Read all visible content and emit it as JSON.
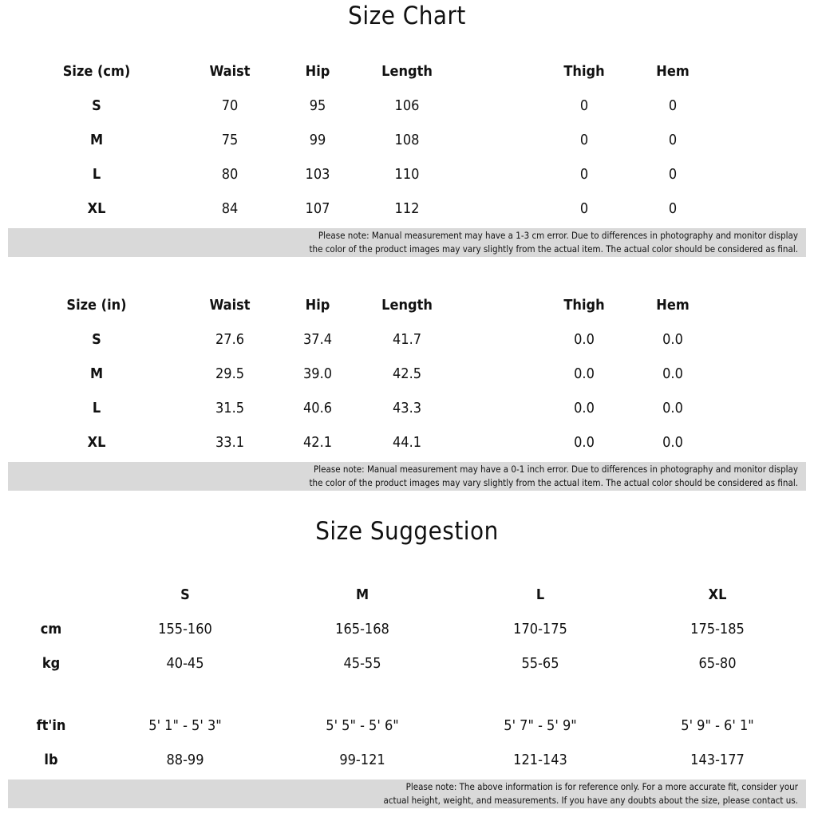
{
  "size_chart": {
    "title": "Size Chart",
    "cm_table": {
      "headers": [
        "Size (cm)",
        "Waist",
        "Hip",
        "Length",
        "Thigh",
        "Hem"
      ],
      "rows": [
        [
          "S",
          "70",
          "95",
          "106",
          "0",
          "0"
        ],
        [
          "M",
          "75",
          "99",
          "108",
          "0",
          "0"
        ],
        [
          "L",
          "80",
          "103",
          "110",
          "0",
          "0"
        ],
        [
          "XL",
          "84",
          "107",
          "112",
          "0",
          "0"
        ]
      ],
      "note_line1": "Please note: Manual measurement may have a 1-3 cm error. Due to differences in photography and monitor display",
      "note_line2": "the color of the product images may vary slightly from the actual item. The actual color should be considered as final."
    },
    "in_table": {
      "headers": [
        "Size (in)",
        "Waist",
        "Hip",
        "Length",
        "Thigh",
        "Hem"
      ],
      "rows": [
        [
          "S",
          "27.6",
          "37.4",
          "41.7",
          "0.0",
          "0.0"
        ],
        [
          "M",
          "29.5",
          "39.0",
          "42.5",
          "0.0",
          "0.0"
        ],
        [
          "L",
          "31.5",
          "40.6",
          "43.3",
          "0.0",
          "0.0"
        ],
        [
          "XL",
          "33.1",
          "42.1",
          "44.1",
          "0.0",
          "0.0"
        ]
      ],
      "note_line1": "Please note: Manual measurement may have a 0-1 inch error. Due to differences in photography and monitor display",
      "note_line2": "the color of the product images may vary slightly from the actual item. The actual color should be considered as final."
    }
  },
  "size_suggestion": {
    "title": "Size Suggestion",
    "headers": [
      "",
      "S",
      "M",
      "L",
      "XL"
    ],
    "rows": [
      [
        "cm",
        "155-160",
        "165-168",
        "170-175",
        "175-185"
      ],
      [
        "kg",
        "40-45",
        "45-55",
        "55-65",
        "65-80"
      ],
      [
        "ft'in",
        "5' 1\" - 5' 3\"",
        "5' 5\" - 5' 6\"",
        "5' 7\" - 5' 9\"",
        "5' 9\" - 6' 1\""
      ],
      [
        "lb",
        "88-99",
        "99-121",
        "121-143",
        "143-177"
      ]
    ],
    "note_line1": "Please note: The above information is for reference only. For a more accurate fit, consider your",
    "note_line2": "actual height, weight, and measurements. If you have any doubts about the size, please contact us."
  }
}
